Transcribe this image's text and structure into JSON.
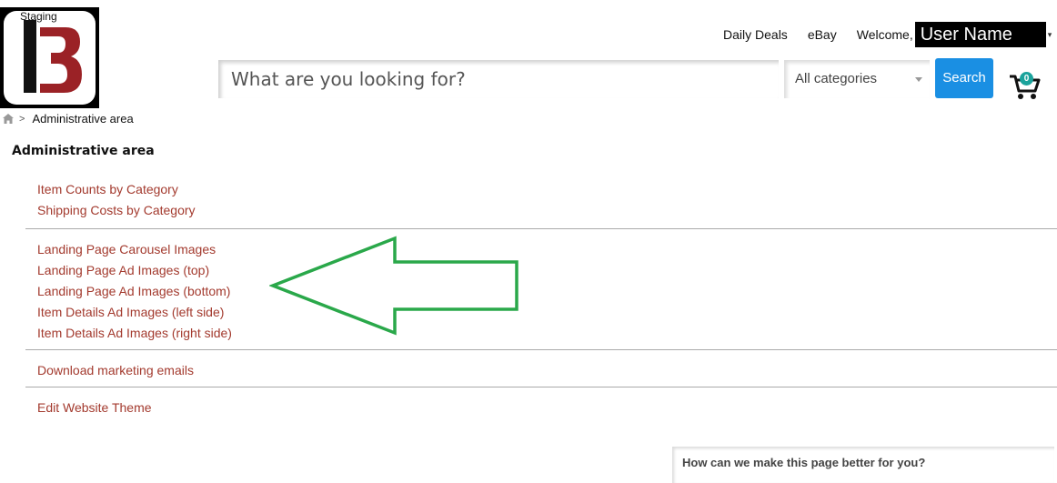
{
  "header": {
    "logo_badge": "Staging",
    "nav": {
      "daily_deals": "Daily Deals",
      "ebay": "eBay",
      "welcome": "Welcome,",
      "user_name": "User Name"
    },
    "search": {
      "placeholder": "What are you looking for?",
      "category": "All categories",
      "button": "Search"
    },
    "cart_count": "0"
  },
  "breadcrumb": {
    "current": "Administrative area"
  },
  "page": {
    "title": "Administrative area",
    "groups": [
      [
        "Item Counts by Category",
        "Shipping Costs by Category"
      ],
      [
        "Landing Page Carousel Images",
        "Landing Page Ad Images (top)",
        "Landing Page Ad Images (bottom)",
        "Item Details Ad Images (left side)",
        "Item Details Ad Images (right side)"
      ],
      [
        "Download marketing emails"
      ],
      [
        "Edit Website Theme"
      ]
    ]
  },
  "feedback": {
    "label": "How can we make this page better for you?"
  },
  "colors": {
    "link": "#a33a2e",
    "search_button": "#1a8fe3",
    "annotation_arrow": "#2aa84a",
    "logo_red": "#9b2226"
  },
  "icons": {
    "home": "home-icon",
    "cart": "cart-icon"
  }
}
